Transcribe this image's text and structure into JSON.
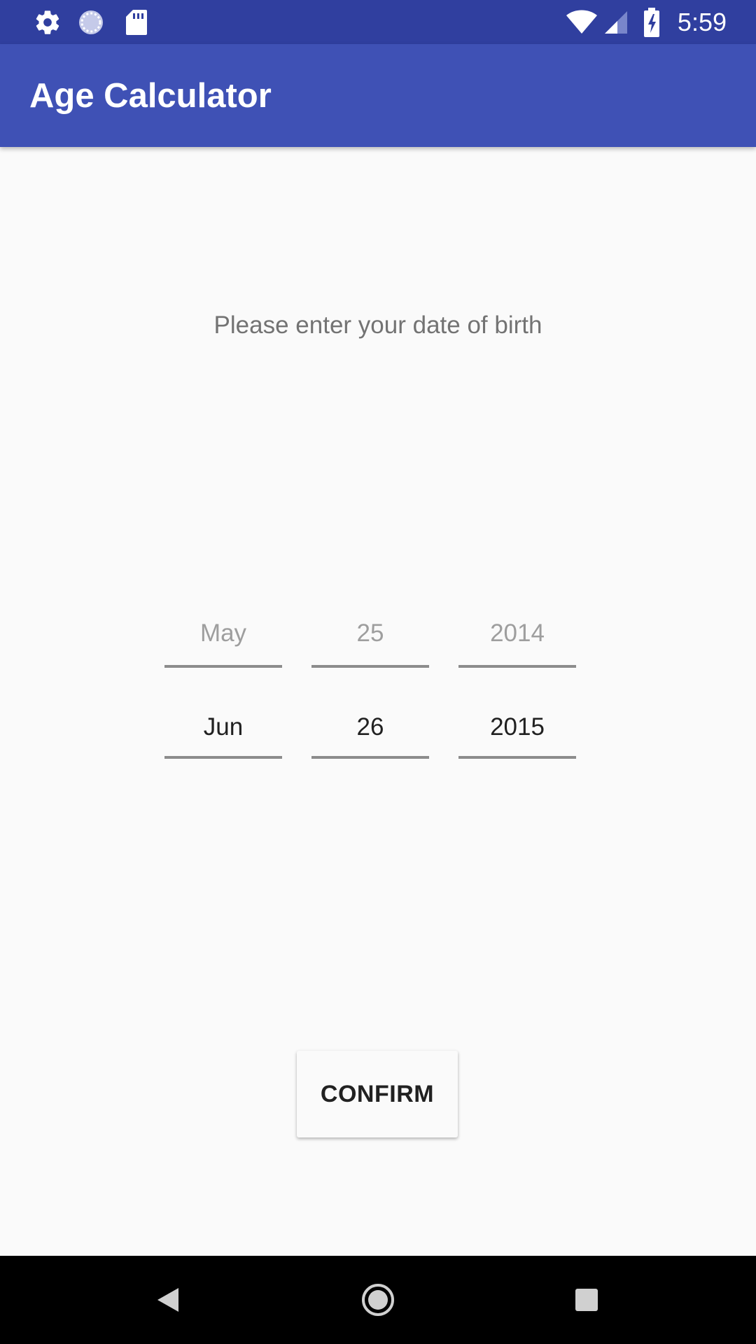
{
  "status_bar": {
    "time": "5:59",
    "left_icons": [
      "settings-icon",
      "sync-circle-icon",
      "sd-card-icon"
    ],
    "right_icons": [
      "wifi-icon",
      "signal-icon",
      "battery-charging-icon"
    ]
  },
  "app_bar": {
    "title": "Age Calculator",
    "color": "#3f51b5"
  },
  "main": {
    "prompt": "Please enter your date of birth",
    "pickers": [
      {
        "name": "month",
        "previous": "May",
        "current": "Jun"
      },
      {
        "name": "day",
        "previous": "25",
        "current": "26"
      },
      {
        "name": "year",
        "previous": "2014",
        "current": "2015"
      }
    ],
    "confirm_label": "CONFIRM"
  },
  "nav_bar": {
    "buttons": [
      "back-icon",
      "home-icon",
      "recents-icon"
    ]
  }
}
